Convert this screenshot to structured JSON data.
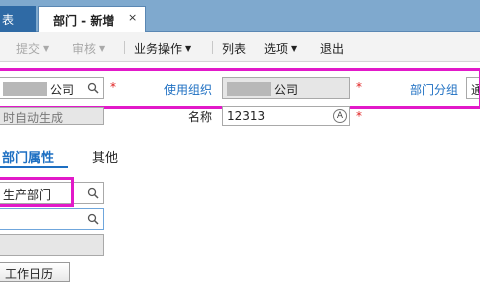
{
  "tabs": {
    "prev_label": "表",
    "active_label": "部门 - 新增",
    "close_glyph": "×"
  },
  "toolbar": {
    "submit_label": "提交",
    "audit_label": "审核",
    "business_label": "业务操作",
    "list_label": "列表",
    "options_label": "选项",
    "exit_label": "退出"
  },
  "form": {
    "create_org_value": "公司",
    "use_org_label": "使用组织",
    "use_org_value": "公司",
    "dept_group_label": "部门分组",
    "dept_group_value": "通",
    "code_value": "时自动生成",
    "name_label": "名称",
    "name_value": "12313",
    "required_mark": "*"
  },
  "subtabs": {
    "attr_label": "部门属性",
    "other_label": "其他"
  },
  "attributes": {
    "dept_type_value": "生产部门",
    "field2_value": "",
    "field3_value": "",
    "calendar_button_label": "工作日历"
  },
  "colors": {
    "highlight": "#e219c9",
    "link_blue": "#1d6fc2",
    "tab_bar": "#7fa9ce"
  }
}
